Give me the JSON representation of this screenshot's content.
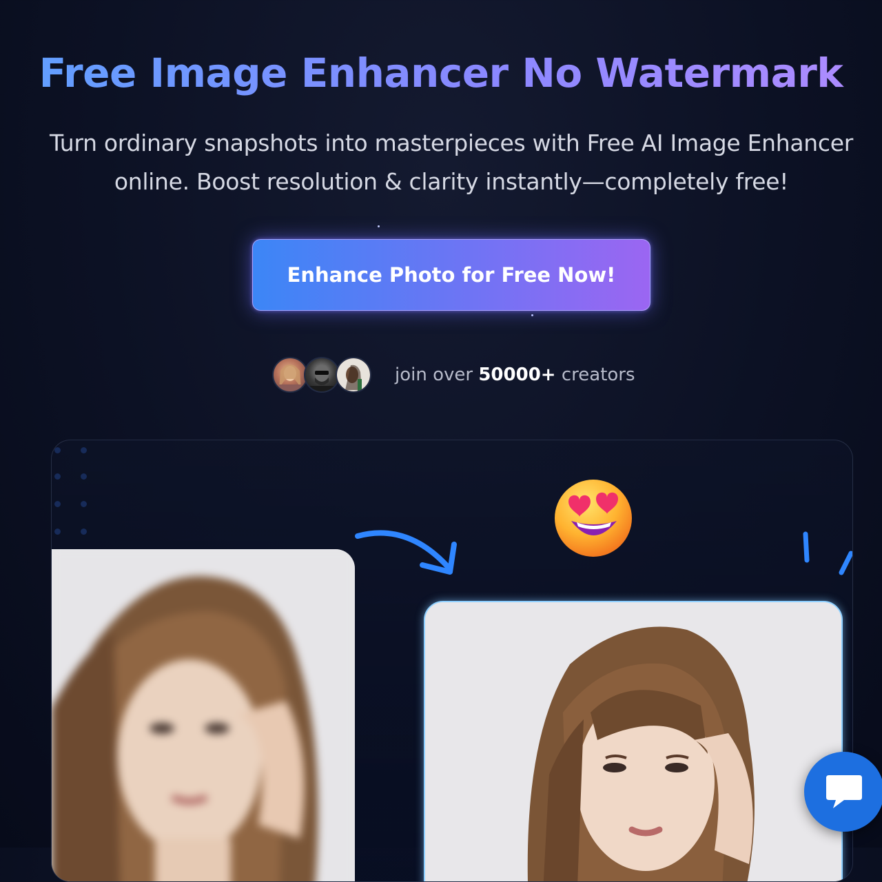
{
  "hero": {
    "title": "Free Image Enhancer No Watermark",
    "subtitle_line1": "Turn ordinary snapshots into masterpieces with Free AI Image Enhancer",
    "subtitle_line2": "online. Boost resolution & clarity instantly—completely free!",
    "cta_label": "Enhance Photo for Free Now!"
  },
  "social_proof": {
    "prefix": "join over",
    "count": "50000+",
    "suffix": "creators",
    "avatars": [
      "creator-avatar-1",
      "creator-avatar-2",
      "creator-avatar-3"
    ]
  },
  "comparison": {
    "before_image": "blurry-portrait-photo",
    "after_image": "enhanced-portrait-photo",
    "emoji": "heart-eyes-emoji",
    "arrow": "curved-arrow-icon"
  },
  "chat": {
    "icon": "chat-bubble-icon"
  },
  "colors": {
    "background": "#0c1124",
    "title_gradient_start": "#5fa0ff",
    "title_gradient_end": "#b08cff",
    "cta_gradient_start": "#3c86f6",
    "cta_gradient_end": "#9b66f2",
    "chat_button": "#1d6fe0",
    "accent_arrow": "#2f86ff"
  }
}
